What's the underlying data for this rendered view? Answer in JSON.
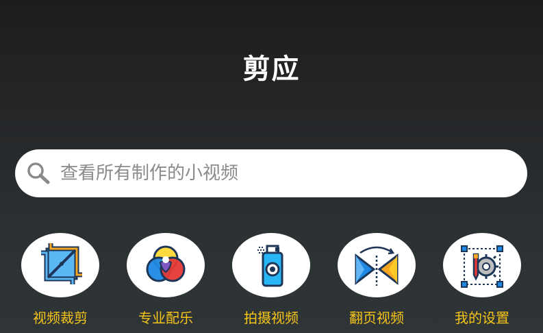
{
  "app": {
    "title": "剪应"
  },
  "search": {
    "placeholder": "查看所有制作的小视频"
  },
  "menu": [
    {
      "label": "视频裁剪",
      "icon": "crop-icon"
    },
    {
      "label": "专业配乐",
      "icon": "color-circles-icon"
    },
    {
      "label": "拍摄视频",
      "icon": "spray-bottle-icon"
    },
    {
      "label": "翻页视频",
      "icon": "flip-arrows-icon"
    },
    {
      "label": "我的设置",
      "icon": "settings-gear-icon"
    }
  ],
  "colors": {
    "label": "#f5c518",
    "background": "#2c3134",
    "accent_orange": "#f5a623",
    "accent_blue": "#1e88e5"
  }
}
